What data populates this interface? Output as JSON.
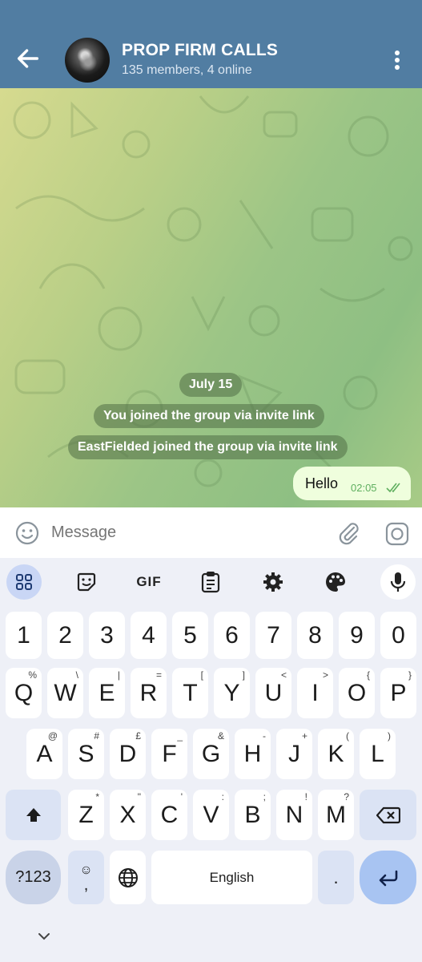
{
  "header": {
    "title": "PROP FIRM CALLS",
    "subtitle": "135 members, 4 online",
    "bg_color": "#517da2",
    "icons": [
      "back-arrow-icon",
      "avatar",
      "more-vert-icon"
    ]
  },
  "chat": {
    "date_label": "July 15",
    "system_messages": [
      "You joined the group via invite link",
      "EastFielded joined the group via invite link"
    ],
    "outgoing_message": {
      "text": "Hello",
      "time": "02:05",
      "status": "read"
    }
  },
  "composer": {
    "placeholder": "Message",
    "icons": [
      "emoji-icon",
      "attach-icon",
      "camera-icon"
    ]
  },
  "keyboard": {
    "toolbar_icons": [
      "apps-grid-icon",
      "sticker-icon",
      "gif-icon",
      "clipboard-icon",
      "gear-icon",
      "palette-icon",
      "mic-icon"
    ],
    "gif_label": "GIF",
    "number_row": [
      "1",
      "2",
      "3",
      "4",
      "5",
      "6",
      "7",
      "8",
      "9",
      "0"
    ],
    "row1": [
      {
        "k": "Q",
        "h": "%"
      },
      {
        "k": "W",
        "h": "\\"
      },
      {
        "k": "E",
        "h": "|"
      },
      {
        "k": "R",
        "h": "="
      },
      {
        "k": "T",
        "h": "["
      },
      {
        "k": "Y",
        "h": "]"
      },
      {
        "k": "U",
        "h": "<"
      },
      {
        "k": "I",
        "h": ">"
      },
      {
        "k": "O",
        "h": "{"
      },
      {
        "k": "P",
        "h": "}"
      }
    ],
    "row2": [
      {
        "k": "A",
        "h": "@"
      },
      {
        "k": "S",
        "h": "#"
      },
      {
        "k": "D",
        "h": "£"
      },
      {
        "k": "F",
        "h": "_"
      },
      {
        "k": "G",
        "h": "&"
      },
      {
        "k": "H",
        "h": "-"
      },
      {
        "k": "J",
        "h": "+"
      },
      {
        "k": "K",
        "h": "("
      },
      {
        "k": "L",
        "h": ")"
      }
    ],
    "row3": [
      {
        "k": "Z",
        "h": "*"
      },
      {
        "k": "X",
        "h": "\""
      },
      {
        "k": "C",
        "h": "'"
      },
      {
        "k": "V",
        "h": ":"
      },
      {
        "k": "B",
        "h": ";"
      },
      {
        "k": "N",
        "h": "!"
      },
      {
        "k": "M",
        "h": "?"
      }
    ],
    "symbols_label": "?123",
    "emoji_comma_top": "☺",
    "emoji_comma_bottom": ",",
    "space_label": "English",
    "period_label": ".",
    "special_icons": [
      "shift-icon",
      "backspace-icon",
      "globe-icon",
      "enter-icon",
      "chevron-down-icon"
    ]
  }
}
